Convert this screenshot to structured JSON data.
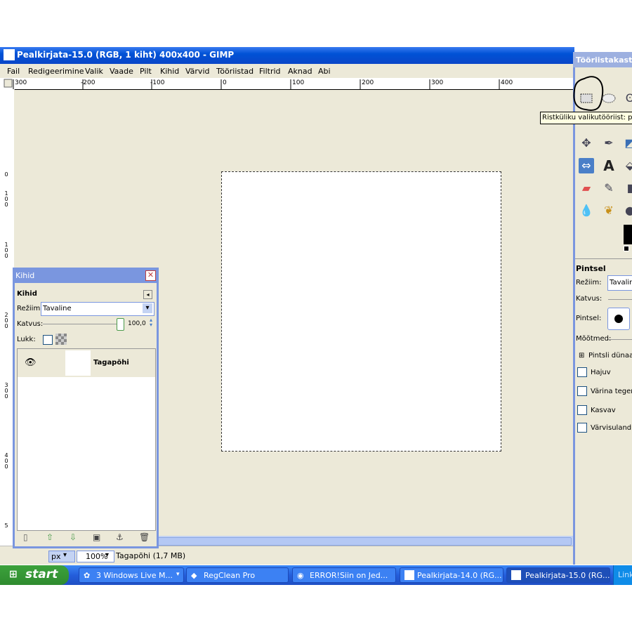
{
  "window": {
    "title": "Pealkirjata-15.0 (RGB, 1 kiht) 400x400 - GIMP"
  },
  "menu": [
    "Fail",
    "Redigeerimine",
    "Valik",
    "Vaade",
    "Pilt",
    "Kihid",
    "Värvid",
    "Tööriistad",
    "Filtrid",
    "Aknad",
    "Abi"
  ],
  "ruler_top": [
    "300",
    "200",
    "100",
    "0",
    "100",
    "200",
    "300",
    "400"
  ],
  "ruler_left": [
    [
      "0"
    ],
    [
      "1",
      "0",
      "0"
    ],
    [
      "2",
      "0",
      "0"
    ],
    [
      "3",
      "0",
      "0"
    ],
    [
      "4",
      "0",
      "0"
    ],
    [
      "5"
    ]
  ],
  "status": {
    "unit": "px",
    "zoom": "100%",
    "info": "Tagapõhi (1,7 MB)"
  },
  "toolbox": {
    "title": "Tööriistakast",
    "tooltip": "Ristküliku valikutööriist: pilc",
    "tool_options": {
      "title": "Pintsel",
      "mode_label": "Režiim:",
      "mode_value": "Tavaline",
      "opacity_label": "Katvus:",
      "brush_label": "Pintsel:",
      "size_label": "Mõõtmed:",
      "dynamics_label": "Pintsli dünaami",
      "checkboxes": [
        "Hajuv",
        "Värina tegemi",
        "Kasvav",
        "Värvisulandus"
      ]
    },
    "icons": [
      "rect-select-icon",
      "ellipse-select-icon",
      "lasso-icon",
      "move-icon",
      "path-icon",
      "transform-icon",
      "flip-icon",
      "text-icon",
      "bucket-icon",
      "eraser-icon",
      "airbrush-icon",
      "ink-icon",
      "blur-icon",
      "smudge-icon",
      "dodge-icon"
    ]
  },
  "layers": {
    "title": "Kihid",
    "header": "Kihid",
    "mode_label": "Režiim:",
    "mode_value": "Tavaline",
    "opacity_label": "Katvus:",
    "opacity_value": "100,0",
    "opacity_fraction": 1.0,
    "lock_label": "Lukk:",
    "items": [
      {
        "name": "Tagapõhi",
        "visible": true
      }
    ]
  },
  "taskbar": {
    "start": "start",
    "items": [
      {
        "label": "3 Windows Live M...",
        "active": false
      },
      {
        "label": "RegClean Pro",
        "active": false
      },
      {
        "label": "ERROR!Siin on Jed...",
        "active": false
      },
      {
        "label": "Pealkirjata-14.0 (RG...",
        "active": false
      },
      {
        "label": "Pealkirjata-15.0 (RG...",
        "active": true
      },
      {
        "label": "Links",
        "active": false
      }
    ]
  },
  "colors": {
    "accent": "#245edb",
    "canvas_bg": "#ece9d8",
    "dialog_border": "#7a96df"
  }
}
